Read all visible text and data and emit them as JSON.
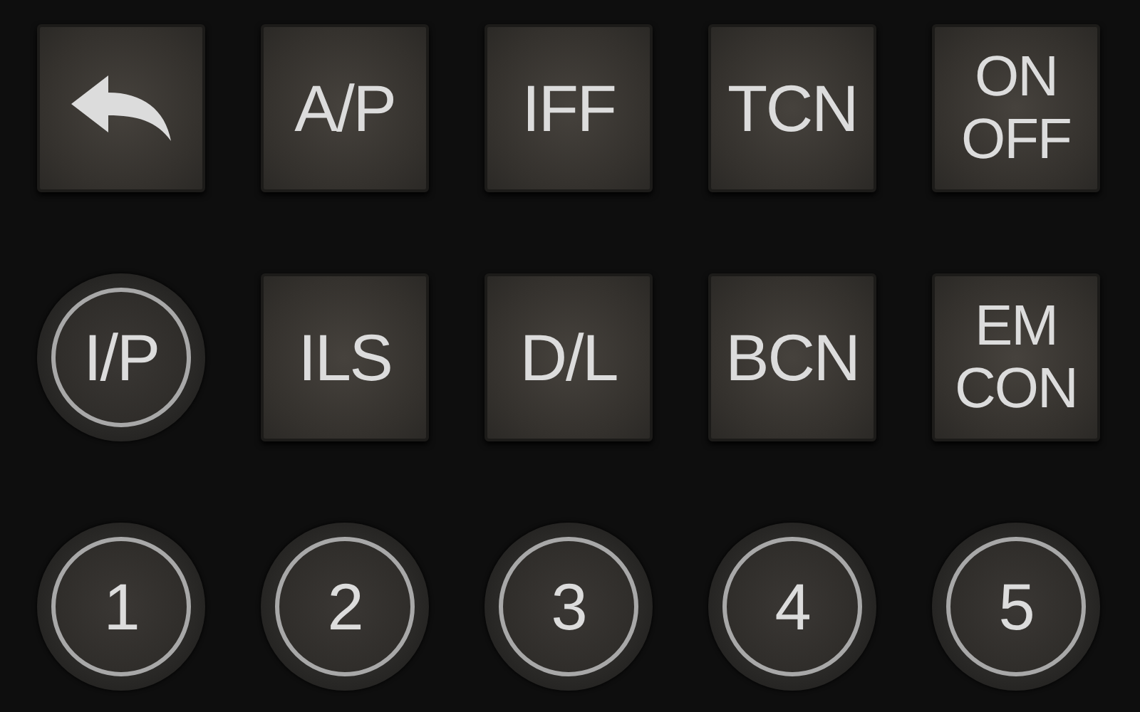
{
  "rows": [
    [
      {
        "kind": "back"
      },
      {
        "kind": "square",
        "lines": [
          "A/P"
        ]
      },
      {
        "kind": "square",
        "lines": [
          "IFF"
        ]
      },
      {
        "kind": "square",
        "lines": [
          "TCN"
        ]
      },
      {
        "kind": "square",
        "lines": [
          "ON",
          "OFF"
        ]
      }
    ],
    [
      {
        "kind": "round",
        "lines": [
          "I/P"
        ]
      },
      {
        "kind": "square",
        "lines": [
          "ILS"
        ]
      },
      {
        "kind": "square",
        "lines": [
          "D/L"
        ]
      },
      {
        "kind": "square",
        "lines": [
          "BCN"
        ]
      },
      {
        "kind": "square",
        "lines": [
          "EM",
          "CON"
        ]
      }
    ],
    [
      {
        "kind": "round",
        "lines": [
          "1"
        ]
      },
      {
        "kind": "round",
        "lines": [
          "2"
        ]
      },
      {
        "kind": "round",
        "lines": [
          "3"
        ]
      },
      {
        "kind": "round",
        "lines": [
          "4"
        ]
      },
      {
        "kind": "round",
        "lines": [
          "5"
        ]
      }
    ]
  ]
}
